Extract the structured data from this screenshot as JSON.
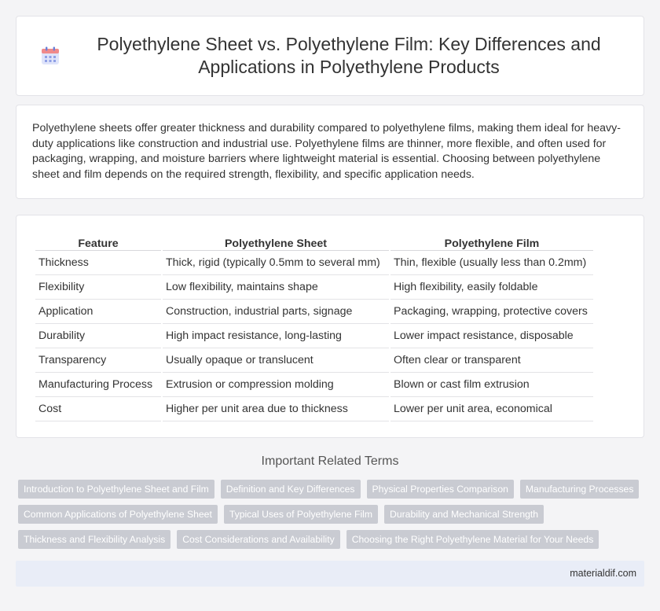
{
  "header": {
    "icon": "calendar-icon",
    "title": "Polyethylene Sheet vs. Polyethylene Film: Key Differences and Applications in Polyethylene Products"
  },
  "summary": "Polyethylene sheets offer greater thickness and durability compared to polyethylene films, making them ideal for heavy-duty applications like construction and industrial use. Polyethylene films are thinner, more flexible, and often used for packaging, wrapping, and moisture barriers where lightweight material is essential. Choosing between polyethylene sheet and film depends on the required strength, flexibility, and specific application needs.",
  "table": {
    "headers": [
      "Feature",
      "Polyethylene Sheet",
      "Polyethylene Film"
    ],
    "rows": [
      [
        "Thickness",
        "Thick, rigid (typically 0.5mm to several mm)",
        "Thin, flexible (usually less than 0.2mm)"
      ],
      [
        "Flexibility",
        "Low flexibility, maintains shape",
        "High flexibility, easily foldable"
      ],
      [
        "Application",
        "Construction, industrial parts, signage",
        "Packaging, wrapping, protective covers"
      ],
      [
        "Durability",
        "High impact resistance, long-lasting",
        "Lower impact resistance, disposable"
      ],
      [
        "Transparency",
        "Usually opaque or translucent",
        "Often clear or transparent"
      ],
      [
        "Manufacturing Process",
        "Extrusion or compression molding",
        "Blown or cast film extrusion"
      ],
      [
        "Cost",
        "Higher per unit area due to thickness",
        "Lower per unit area, economical"
      ]
    ]
  },
  "related": {
    "title": "Important Related Terms",
    "rows": [
      [
        "Introduction to Polyethylene Sheet and Film",
        "Definition and Key Differences",
        "Physical Properties Comparison",
        "Manufacturing Processes"
      ],
      [
        "Common Applications of Polyethylene Sheet",
        "Typical Uses of Polyethylene Film",
        "Durability and Mechanical Strength"
      ],
      [
        "Thickness and Flexibility Analysis",
        "Cost Considerations and Availability",
        "Choosing the Right Polyethylene Material for Your Needs"
      ]
    ]
  },
  "footer": {
    "site": "materialdif.com"
  },
  "colors": {
    "tag_bg": "#c9cbd2",
    "footer_bg": "#e9edf7",
    "icon_accent": "#6b7fd7",
    "icon_top": "#f08a8a"
  }
}
